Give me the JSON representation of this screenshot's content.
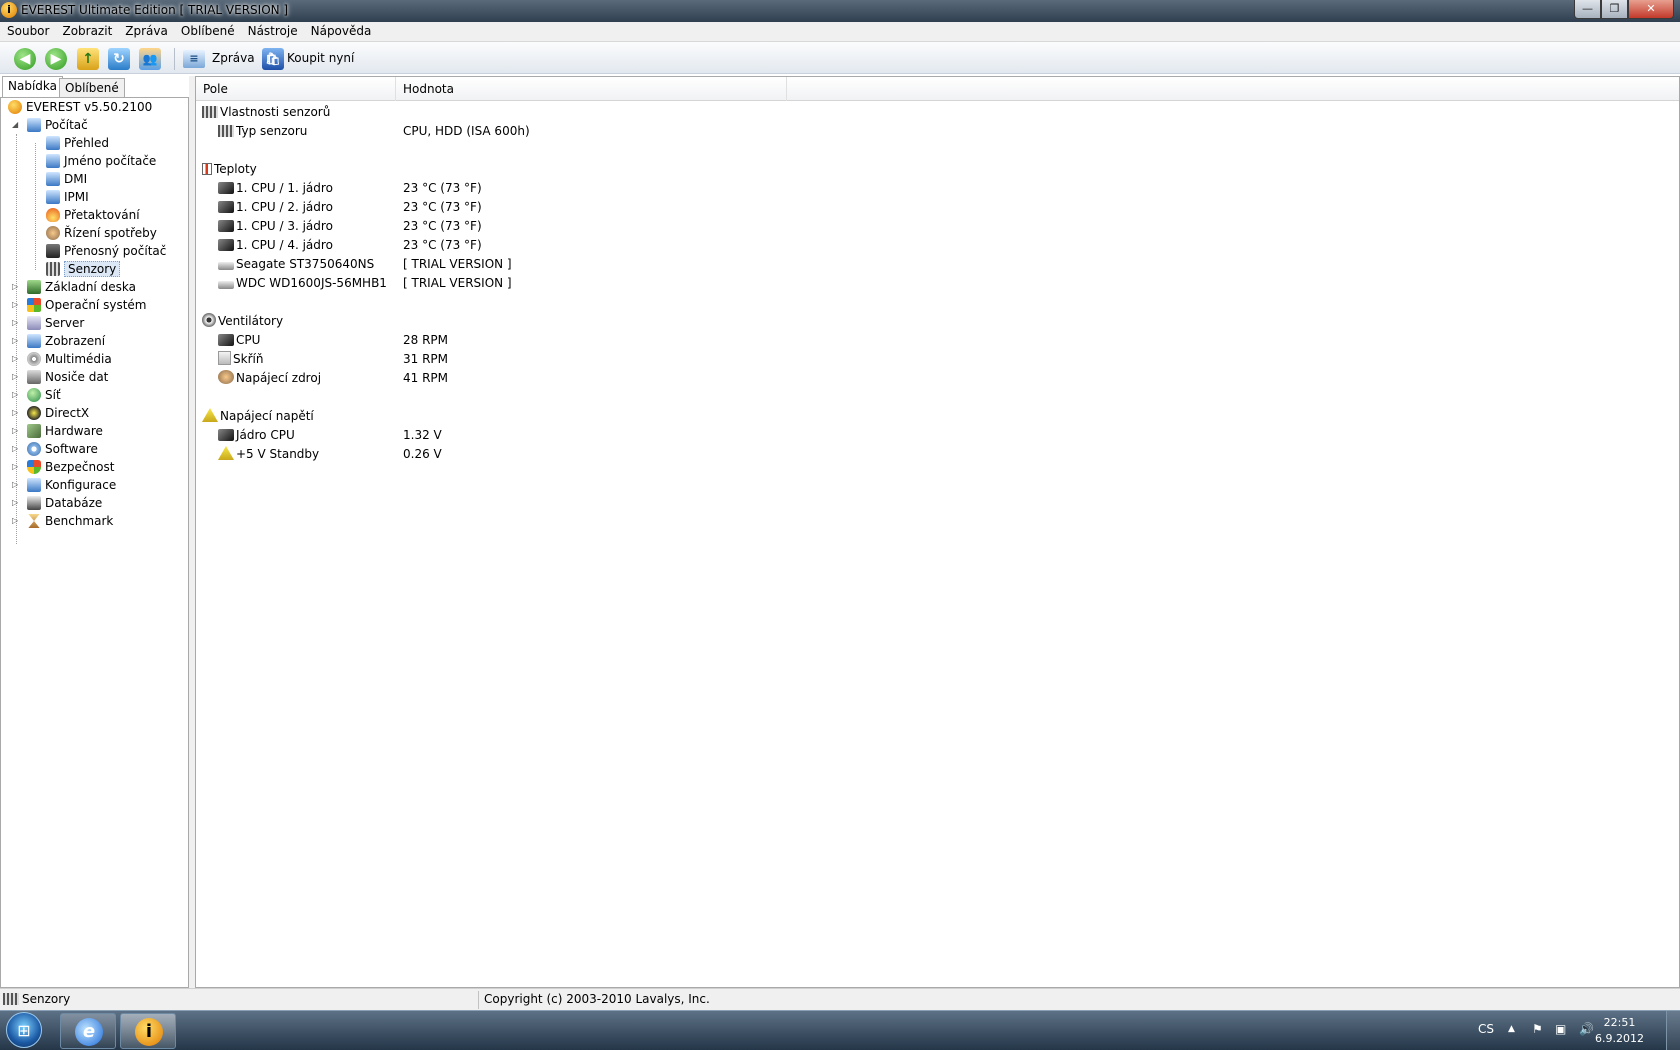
{
  "window": {
    "title": "EVEREST Ultimate Edition  [ TRIAL VERSION ]",
    "buttons": {
      "minimize": "—",
      "maximize": "❐",
      "close": "✕"
    }
  },
  "menu": [
    "Soubor",
    "Zobrazit",
    "Zpráva",
    "Oblíbené",
    "Nástroje",
    "Nápověda"
  ],
  "toolbar": {
    "report_label": "Zpráva",
    "buy_label": "Koupit nyní"
  },
  "tabs": [
    "Nabídka",
    "Oblíbené"
  ],
  "tree": {
    "root": "EVEREST v5.50.2100",
    "computer": "Počítač",
    "computer_children": [
      "Přehled",
      "Jméno počítače",
      "DMI",
      "IPMI",
      "Přetaktování",
      "Řízení spotřeby",
      "Přenosný počítač",
      "Senzory"
    ],
    "selected": "Senzory",
    "categories": [
      "Základní deska",
      "Operační systém",
      "Server",
      "Zobrazení",
      "Multimédia",
      "Nosiče dat",
      "Síť",
      "DirectX",
      "Hardware",
      "Software",
      "Bezpečnost",
      "Konfigurace",
      "Databáze",
      "Benchmark"
    ]
  },
  "columns": [
    "Pole",
    "Hodnota"
  ],
  "sections": [
    {
      "title": "Vlastnosti senzorů",
      "rows": [
        {
          "field": "Typ senzoru",
          "value": "CPU, HDD  (ISA 600h)"
        }
      ]
    },
    {
      "title": "Teploty",
      "rows": [
        {
          "field": "1. CPU / 1. jádro",
          "value": "23 °C  (73 °F)"
        },
        {
          "field": "1. CPU / 2. jádro",
          "value": "23 °C  (73 °F)"
        },
        {
          "field": "1. CPU / 3. jádro",
          "value": "23 °C  (73 °F)"
        },
        {
          "field": "1. CPU / 4. jádro",
          "value": "23 °C  (73 °F)"
        },
        {
          "field": "Seagate ST3750640NS",
          "value": "[ TRIAL VERSION ]"
        },
        {
          "field": "WDC WD1600JS-56MHB1",
          "value": "[ TRIAL VERSION ]"
        }
      ]
    },
    {
      "title": "Ventilátory",
      "rows": [
        {
          "field": "CPU",
          "value": "28 RPM"
        },
        {
          "field": "Skříň",
          "value": "31 RPM"
        },
        {
          "field": "Napájecí zdroj",
          "value": "41 RPM"
        }
      ]
    },
    {
      "title": "Napájecí napětí",
      "rows": [
        {
          "field": "Jádro CPU",
          "value": "1.32 V"
        },
        {
          "field": "+5 V Standby",
          "value": "0.26 V"
        }
      ]
    }
  ],
  "status": {
    "left": "Senzory",
    "right": "Copyright (c) 2003-2010 Lavalys, Inc."
  },
  "taskbar": {
    "language": "CS",
    "time": "22:51",
    "date": "6.9.2012"
  }
}
